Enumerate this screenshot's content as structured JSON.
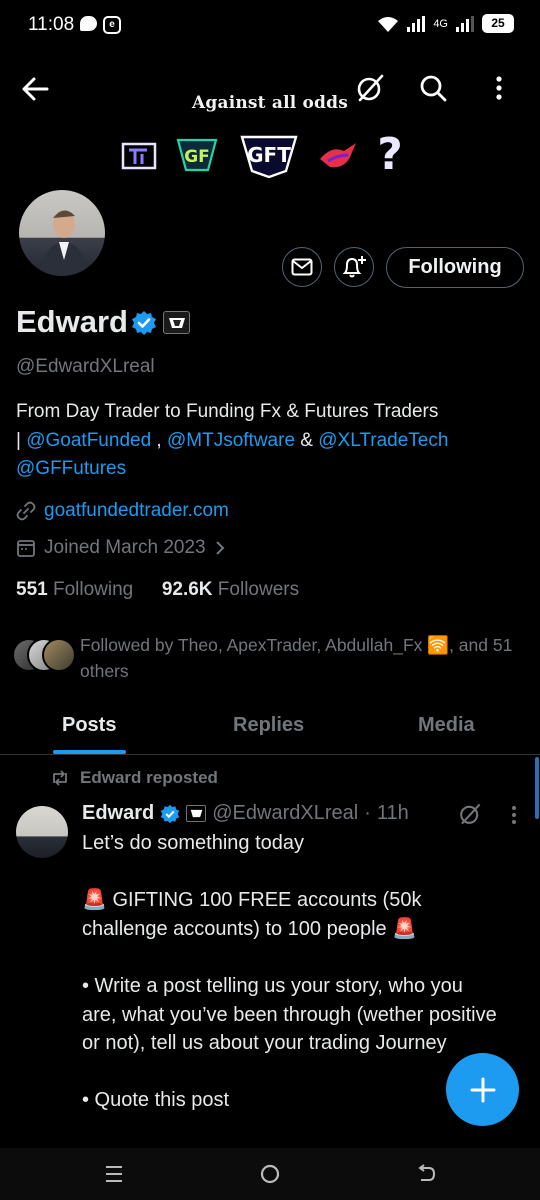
{
  "status_bar": {
    "time": "11:08",
    "network_label": "4G",
    "battery": "25"
  },
  "header": {
    "banner_title": "Against all odds",
    "banner_logos": [
      "mtj-logo",
      "gf-logo",
      "gft-logo",
      "bird-logo",
      "question-mark"
    ],
    "question_mark": "?"
  },
  "profile": {
    "name": "Edward",
    "handle": "@EdwardXLreal",
    "bio_text": "From Day Trader to Funding Fx & Futures Traders",
    "bio_sep_1": "| ",
    "bio_mention_1": "@GoatFunded",
    "bio_sep_2": " , ",
    "bio_mention_2": "@MTJsoftware",
    "bio_sep_3": " & ",
    "bio_mention_3": "@XLTradeTech",
    "bio_mention_4": "@GFFutures",
    "website": "goatfundedtrader.com",
    "joined": "Joined March 2023",
    "following_count": "551",
    "following_label": "Following",
    "followers_count": "92.6K",
    "followers_label": "Followers",
    "followed_by": "Followed by Theo, ApexTrader, Abdullah_Fx 🛜, and 51 others",
    "follow_button_label": "Following"
  },
  "tabs": [
    {
      "label": "Posts",
      "active": true
    },
    {
      "label": "Replies",
      "active": false
    },
    {
      "label": "Media",
      "active": false
    }
  ],
  "post": {
    "repost_text": "Edward reposted",
    "author_name": "Edward",
    "author_handle": "@EdwardXLreal",
    "separator": "·",
    "time": "11h",
    "body": "Let’s do something today\n\n🚨 GIFTING 100 FREE accounts (50k challenge accounts) to 100 people 🚨\n\n• Write a post telling us your story, who you are, what you’ve been through (wether positive or not), tell us about your trading Journey\n\n• Quote this post"
  },
  "colors": {
    "accent": "#1d9bf0",
    "background": "#000000",
    "muted_text": "#71767b",
    "primary_text": "#e7e9ea",
    "border": "#536471"
  }
}
